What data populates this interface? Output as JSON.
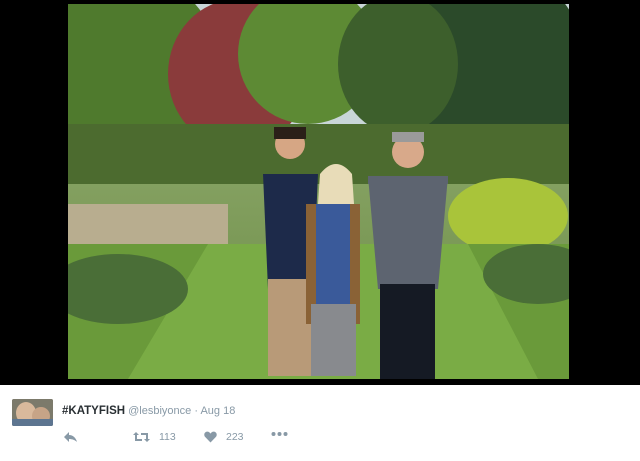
{
  "tweet": {
    "display_name": "#KATYFISH",
    "handle": "@lesbiyonce",
    "separator": "·",
    "date": "Aug 18",
    "actions": {
      "reply_icon": "reply-icon",
      "retweet_icon": "retweet-icon",
      "retweet_count": "113",
      "like_icon": "heart-icon",
      "like_count": "223",
      "more_icon": "more-dots-icon"
    }
  },
  "colors": {
    "name_text": "#292f33",
    "meta_text": "#8899a6",
    "photo_border": "#000000"
  }
}
